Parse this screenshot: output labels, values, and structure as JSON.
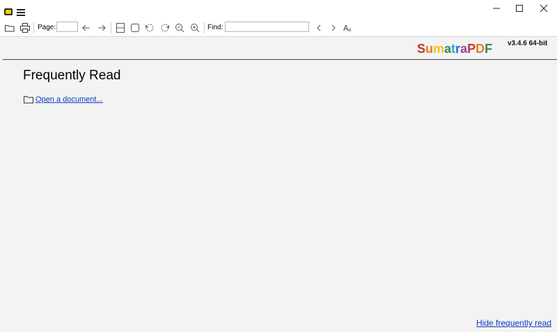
{
  "app": {
    "logo": [
      "S",
      "u",
      "m",
      "a",
      "t",
      "r",
      "a",
      "P",
      "D",
      "F"
    ],
    "logo_colors": [
      "#c0392b",
      "#e67e22",
      "#f1c40f",
      "#2e8b57",
      "#3aa0d8",
      "#2a6bd1",
      "#8e44ad",
      "#c0392b",
      "#e67e22",
      "#2e8b57"
    ],
    "version": "v3.4.6 64-bit"
  },
  "toolbar": {
    "page_label": "Page:",
    "page_value": "",
    "find_label": "Find:",
    "find_value": ""
  },
  "main": {
    "heading": "Frequently Read",
    "open_document_link": "Open a document...",
    "hide_link": "Hide frequently read"
  },
  "colors": {
    "link": "#0b3cc1",
    "background": "#f3f3f3"
  }
}
